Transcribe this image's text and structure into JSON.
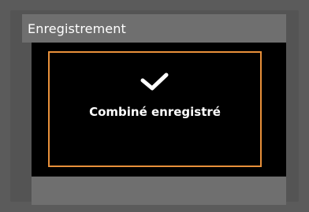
{
  "header": {
    "title": "Enregistrement"
  },
  "dialog": {
    "icon": "checkmark-icon",
    "message": "Combiné enregistré",
    "border_color": "#e8903a"
  },
  "colors": {
    "background": "#5b5b5b",
    "title_bar": "#6f6f6f",
    "content": "#000000",
    "text": "#ffffff"
  }
}
